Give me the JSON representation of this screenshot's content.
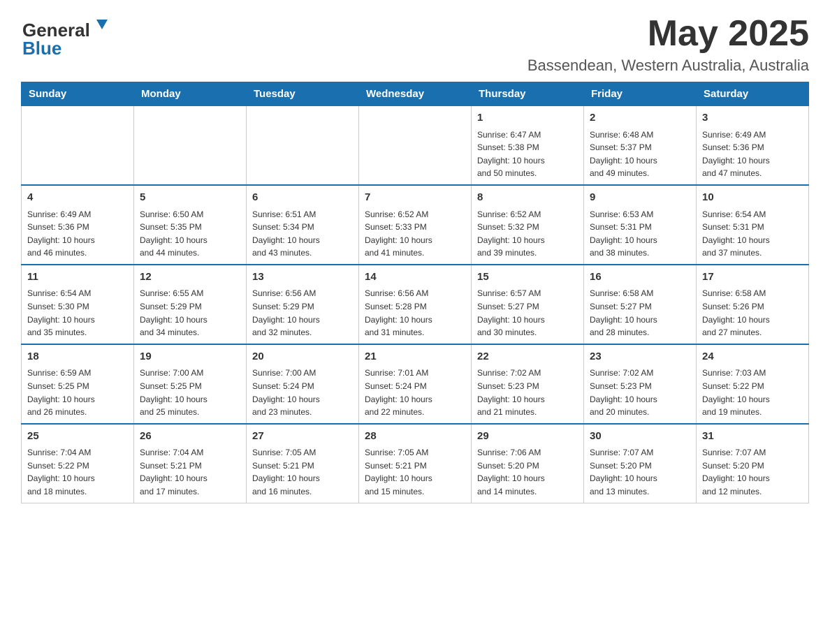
{
  "header": {
    "logo_general": "General",
    "logo_blue": "Blue",
    "month_title": "May 2025",
    "location": "Bassendean, Western Australia, Australia"
  },
  "weekdays": [
    "Sunday",
    "Monday",
    "Tuesday",
    "Wednesday",
    "Thursday",
    "Friday",
    "Saturday"
  ],
  "weeks": [
    [
      {
        "day": "",
        "info": ""
      },
      {
        "day": "",
        "info": ""
      },
      {
        "day": "",
        "info": ""
      },
      {
        "day": "",
        "info": ""
      },
      {
        "day": "1",
        "info": "Sunrise: 6:47 AM\nSunset: 5:38 PM\nDaylight: 10 hours\nand 50 minutes."
      },
      {
        "day": "2",
        "info": "Sunrise: 6:48 AM\nSunset: 5:37 PM\nDaylight: 10 hours\nand 49 minutes."
      },
      {
        "day": "3",
        "info": "Sunrise: 6:49 AM\nSunset: 5:36 PM\nDaylight: 10 hours\nand 47 minutes."
      }
    ],
    [
      {
        "day": "4",
        "info": "Sunrise: 6:49 AM\nSunset: 5:36 PM\nDaylight: 10 hours\nand 46 minutes."
      },
      {
        "day": "5",
        "info": "Sunrise: 6:50 AM\nSunset: 5:35 PM\nDaylight: 10 hours\nand 44 minutes."
      },
      {
        "day": "6",
        "info": "Sunrise: 6:51 AM\nSunset: 5:34 PM\nDaylight: 10 hours\nand 43 minutes."
      },
      {
        "day": "7",
        "info": "Sunrise: 6:52 AM\nSunset: 5:33 PM\nDaylight: 10 hours\nand 41 minutes."
      },
      {
        "day": "8",
        "info": "Sunrise: 6:52 AM\nSunset: 5:32 PM\nDaylight: 10 hours\nand 39 minutes."
      },
      {
        "day": "9",
        "info": "Sunrise: 6:53 AM\nSunset: 5:31 PM\nDaylight: 10 hours\nand 38 minutes."
      },
      {
        "day": "10",
        "info": "Sunrise: 6:54 AM\nSunset: 5:31 PM\nDaylight: 10 hours\nand 37 minutes."
      }
    ],
    [
      {
        "day": "11",
        "info": "Sunrise: 6:54 AM\nSunset: 5:30 PM\nDaylight: 10 hours\nand 35 minutes."
      },
      {
        "day": "12",
        "info": "Sunrise: 6:55 AM\nSunset: 5:29 PM\nDaylight: 10 hours\nand 34 minutes."
      },
      {
        "day": "13",
        "info": "Sunrise: 6:56 AM\nSunset: 5:29 PM\nDaylight: 10 hours\nand 32 minutes."
      },
      {
        "day": "14",
        "info": "Sunrise: 6:56 AM\nSunset: 5:28 PM\nDaylight: 10 hours\nand 31 minutes."
      },
      {
        "day": "15",
        "info": "Sunrise: 6:57 AM\nSunset: 5:27 PM\nDaylight: 10 hours\nand 30 minutes."
      },
      {
        "day": "16",
        "info": "Sunrise: 6:58 AM\nSunset: 5:27 PM\nDaylight: 10 hours\nand 28 minutes."
      },
      {
        "day": "17",
        "info": "Sunrise: 6:58 AM\nSunset: 5:26 PM\nDaylight: 10 hours\nand 27 minutes."
      }
    ],
    [
      {
        "day": "18",
        "info": "Sunrise: 6:59 AM\nSunset: 5:25 PM\nDaylight: 10 hours\nand 26 minutes."
      },
      {
        "day": "19",
        "info": "Sunrise: 7:00 AM\nSunset: 5:25 PM\nDaylight: 10 hours\nand 25 minutes."
      },
      {
        "day": "20",
        "info": "Sunrise: 7:00 AM\nSunset: 5:24 PM\nDaylight: 10 hours\nand 23 minutes."
      },
      {
        "day": "21",
        "info": "Sunrise: 7:01 AM\nSunset: 5:24 PM\nDaylight: 10 hours\nand 22 minutes."
      },
      {
        "day": "22",
        "info": "Sunrise: 7:02 AM\nSunset: 5:23 PM\nDaylight: 10 hours\nand 21 minutes."
      },
      {
        "day": "23",
        "info": "Sunrise: 7:02 AM\nSunset: 5:23 PM\nDaylight: 10 hours\nand 20 minutes."
      },
      {
        "day": "24",
        "info": "Sunrise: 7:03 AM\nSunset: 5:22 PM\nDaylight: 10 hours\nand 19 minutes."
      }
    ],
    [
      {
        "day": "25",
        "info": "Sunrise: 7:04 AM\nSunset: 5:22 PM\nDaylight: 10 hours\nand 18 minutes."
      },
      {
        "day": "26",
        "info": "Sunrise: 7:04 AM\nSunset: 5:21 PM\nDaylight: 10 hours\nand 17 minutes."
      },
      {
        "day": "27",
        "info": "Sunrise: 7:05 AM\nSunset: 5:21 PM\nDaylight: 10 hours\nand 16 minutes."
      },
      {
        "day": "28",
        "info": "Sunrise: 7:05 AM\nSunset: 5:21 PM\nDaylight: 10 hours\nand 15 minutes."
      },
      {
        "day": "29",
        "info": "Sunrise: 7:06 AM\nSunset: 5:20 PM\nDaylight: 10 hours\nand 14 minutes."
      },
      {
        "day": "30",
        "info": "Sunrise: 7:07 AM\nSunset: 5:20 PM\nDaylight: 10 hours\nand 13 minutes."
      },
      {
        "day": "31",
        "info": "Sunrise: 7:07 AM\nSunset: 5:20 PM\nDaylight: 10 hours\nand 12 minutes."
      }
    ]
  ]
}
